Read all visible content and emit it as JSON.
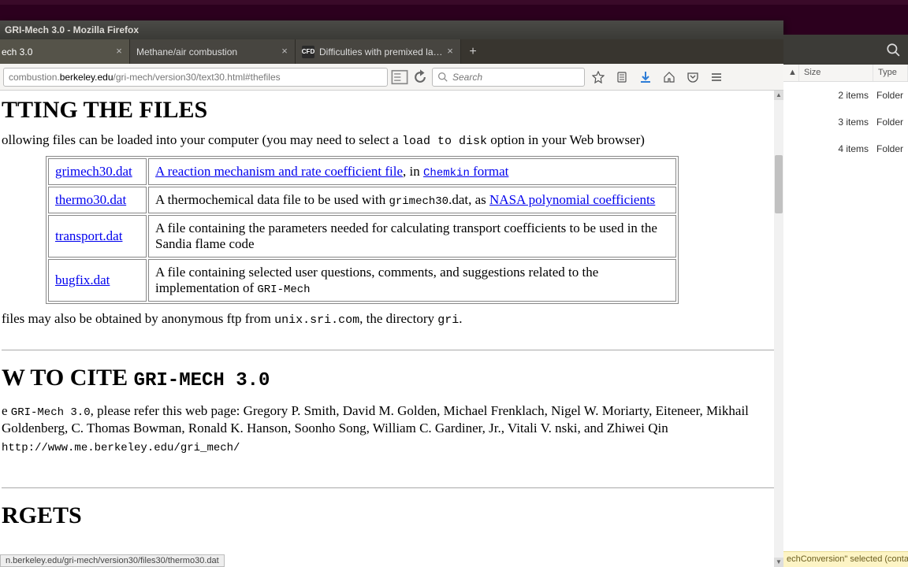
{
  "window": {
    "title": "GRI-Mech 3.0 - Mozilla Firefox"
  },
  "tabs": [
    {
      "label": "ech 3.0"
    },
    {
      "label": "Methane/air combustion"
    },
    {
      "label": "Difficulties with premixed la…"
    }
  ],
  "url": {
    "prefix": "combustion.",
    "domain": "berkeley.edu",
    "path": "/gri-mech/version30/text30.html#thefiles"
  },
  "search": {
    "placeholder": "Search"
  },
  "page": {
    "h1": "TTING THE FILES",
    "intro_pre": "ollowing files can be loaded into your computer (you may need to select a ",
    "intro_code": "load to disk",
    "intro_post": " option in your Web browser)",
    "files": [
      {
        "name": "grimech30.dat",
        "desc_link": "A reaction mechanism and rate coefficient file",
        "desc_mid": ", in ",
        "desc_code": "Chemkin",
        "desc_link2": " format"
      },
      {
        "name": "thermo30.dat",
        "desc_pre": "A thermochemical data file to be used with ",
        "desc_code": "grimech30",
        "desc_mid": ".dat, as ",
        "desc_link": "NASA polynomial coefficients"
      },
      {
        "name": "transport.dat",
        "desc": "A file containing the parameters needed for calculating transport coefficients to be used in the Sandia flame code"
      },
      {
        "name": "bugfix.dat",
        "desc_pre": "A file containing selected user questions, comments, and suggestions related to the implementation of ",
        "desc_code": "GRI-Mech"
      }
    ],
    "ftp_pre": " files may also be obtained by anonymous ftp from ",
    "ftp_host": "unix.sri.com",
    "ftp_mid": ", the directory ",
    "ftp_dir": "gri",
    "ftp_end": ".",
    "cite_h_pre": "W TO CITE ",
    "cite_h_code": "GRI-MECH 3.0",
    "cite_pre1": "e ",
    "cite_code1": "GRI-Mech 3.0",
    "cite_body": ", please refer this web page: Gregory P. Smith, David M. Golden, Michael Frenklach, Nigel W. Moriarty, Eiteneer, Mikhail Goldenberg, C. Thomas Bowman, Ronald K. Hanson, Soonho Song, William C. Gardiner, Jr., Vitali V. nski, and Zhiwei Qin ",
    "cite_url": "http://www.me.berkeley.edu/gri_mech/",
    "targets_h": "RGETS",
    "status": "n.berkeley.edu/gri-mech/version30/files30/thermo30.dat"
  },
  "fm": {
    "cols": {
      "size": "Size",
      "type": "Type"
    },
    "rows": [
      {
        "size": "2 items",
        "type": "Folder"
      },
      {
        "size": "3 items",
        "type": "Folder"
      },
      {
        "size": "4 items",
        "type": "Folder"
      }
    ],
    "status": "echConversion\" selected (conta"
  }
}
